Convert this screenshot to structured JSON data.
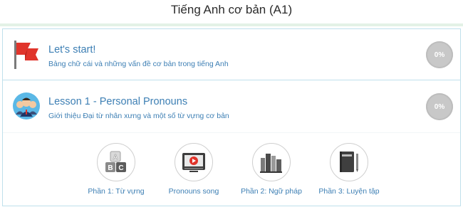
{
  "page": {
    "title": "Tiếng Anh cơ bản (A1)"
  },
  "lessons": [
    {
      "title": "Let's start!",
      "subtitle": "Bảng chữ cái và những vấn đề cơ bản trong tiếng Anh",
      "progress": "0%",
      "icon": "red-flag-icon"
    },
    {
      "title": "Lesson 1 - Personal Pronouns",
      "subtitle": "Giới thiệu Đại từ nhân xưng và một số từ vựng cơ bản",
      "progress": "0%",
      "icon": "people-group-icon"
    }
  ],
  "parts": [
    {
      "label": "Phần 1: Từ vựng",
      "icon": "abc-blocks-icon"
    },
    {
      "label": "Pronouns song",
      "icon": "video-player-icon"
    },
    {
      "label": "Phần 2: Ngữ pháp",
      "icon": "books-icon"
    },
    {
      "label": "Phần 3: Luyện tập",
      "icon": "notebook-pencil-icon"
    }
  ],
  "colors": {
    "link": "#3d7fb4",
    "border": "#bfe0ec",
    "progress": "#c8c8c8",
    "flag": "#e0342b"
  }
}
